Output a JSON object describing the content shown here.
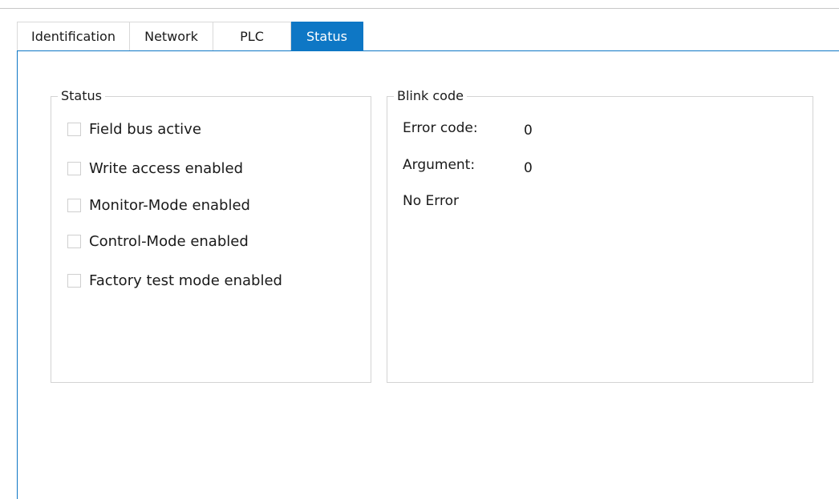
{
  "tabs": {
    "identification": "Identification",
    "network": "Network",
    "plc": "PLC",
    "status": "Status",
    "active": "status"
  },
  "status_group": {
    "title": "Status",
    "items": [
      {
        "label": "Field bus active",
        "checked": false
      },
      {
        "label": "Write access enabled",
        "checked": false
      },
      {
        "label": "Monitor-Mode enabled",
        "checked": false
      },
      {
        "label": "Control-Mode enabled",
        "checked": false
      },
      {
        "label": "Factory test mode enabled",
        "checked": false
      }
    ]
  },
  "blink_group": {
    "title": "Blink code",
    "error_code_label": "Error code:",
    "error_code_value": "0",
    "argument_label": "Argument:",
    "argument_value": "0",
    "message": "No Error"
  },
  "colors": {
    "accent": "#0e77c5",
    "group_border": "#d3d3d3",
    "checkbox_border": "#cfcfcf"
  }
}
